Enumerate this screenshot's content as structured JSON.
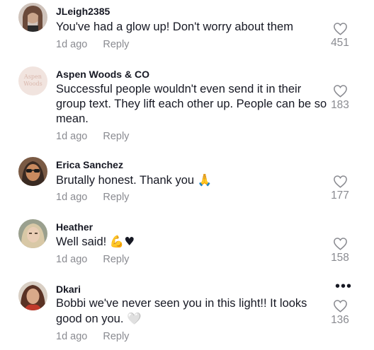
{
  "comments": [
    {
      "username": "JLeigh2385",
      "text": "You've had a glow up! Don't worry about them",
      "time": "1d ago",
      "reply": "Reply",
      "likes": "451",
      "avatar_colors": [
        "#6b4a3a",
        "#c9a58c"
      ]
    },
    {
      "username": "Aspen Woods & CO",
      "text": "Successful people wouldn't even send it in their group text. They lift each other up. People can be so mean.",
      "time": "1d ago",
      "reply": "Reply",
      "likes": "183",
      "avatar_logo": "Aspen Woods",
      "avatar_colors": [
        "#f1e4df",
        "#d9b7ac"
      ]
    },
    {
      "username": "Erica Sanchez",
      "text": "Brutally honest. Thank you",
      "emoji": "🙏",
      "time": "1d ago",
      "reply": "Reply",
      "likes": "177",
      "avatar_colors": [
        "#3a2a22",
        "#c88a5f"
      ]
    },
    {
      "username": "Heather",
      "text": "Well said!",
      "emoji": "💪♥",
      "time": "1d ago",
      "reply": "Reply",
      "likes": "158",
      "avatar_colors": [
        "#d8c8a6",
        "#7f8a78"
      ]
    },
    {
      "username": "Dkari",
      "text": "Bobbi we've never seen you in this light!! It looks good on you.",
      "emoji": "🤍",
      "time": "1d ago",
      "reply": "Reply",
      "likes": "136",
      "more": "•••",
      "avatar_colors": [
        "#5a3224",
        "#c0392b"
      ]
    }
  ]
}
